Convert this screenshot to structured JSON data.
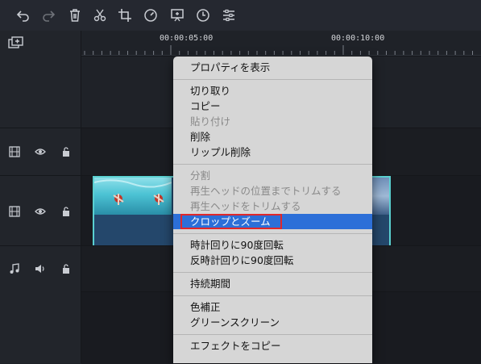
{
  "toolbar": {
    "buttons": [
      {
        "icon": "undo-icon",
        "enabled": true
      },
      {
        "icon": "redo-icon",
        "enabled": false
      },
      {
        "icon": "trash-icon",
        "enabled": true
      },
      {
        "icon": "scissors-icon",
        "enabled": true
      },
      {
        "icon": "crop-icon",
        "enabled": true
      },
      {
        "icon": "speed-icon",
        "enabled": true
      },
      {
        "icon": "snapshot-icon",
        "enabled": true
      },
      {
        "icon": "clock-icon",
        "enabled": true
      },
      {
        "icon": "sliders-icon",
        "enabled": true
      }
    ]
  },
  "ruler": {
    "labels": [
      "00:00:05:00",
      "00:00:10:00"
    ]
  },
  "tracks": [
    {
      "type": "video",
      "icons": [
        "film-icon",
        "eye-icon",
        "lock-open-icon"
      ]
    },
    {
      "type": "video",
      "icons": [
        "film-icon",
        "eye-icon",
        "lock-open-icon"
      ]
    },
    {
      "type": "audio",
      "icons": [
        "music-note-icon",
        "speaker-icon",
        "lock-open-icon"
      ]
    }
  ],
  "context_menu": {
    "groups": [
      [
        {
          "label": "プロパティを表示",
          "enabled": true
        }
      ],
      [
        {
          "label": "切り取り",
          "enabled": true
        },
        {
          "label": "コピー",
          "enabled": true
        },
        {
          "label": "貼り付け",
          "enabled": false
        },
        {
          "label": "削除",
          "enabled": true
        },
        {
          "label": "リップル削除",
          "enabled": true
        }
      ],
      [
        {
          "label": "分割",
          "enabled": false
        },
        {
          "label": "再生ヘッドの位置までトリムする",
          "enabled": false
        },
        {
          "label": "再生ヘッドをトリムする",
          "enabled": false
        },
        {
          "label": "クロップとズーム",
          "enabled": true,
          "highlighted": true
        }
      ],
      [
        {
          "label": "時計回りに90度回転",
          "enabled": true
        },
        {
          "label": "反時計回りに90度回転",
          "enabled": true
        }
      ],
      [
        {
          "label": "持続期間",
          "enabled": true
        }
      ],
      [
        {
          "label": "色補正",
          "enabled": true
        },
        {
          "label": "グリーンスクリーン",
          "enabled": true
        }
      ],
      [
        {
          "label": "エフェクトをコピー",
          "enabled": true
        }
      ]
    ]
  },
  "colors": {
    "highlight": "#2c6fd8",
    "callout_border": "#e0272a",
    "clip_border": "#5ad0d0"
  }
}
